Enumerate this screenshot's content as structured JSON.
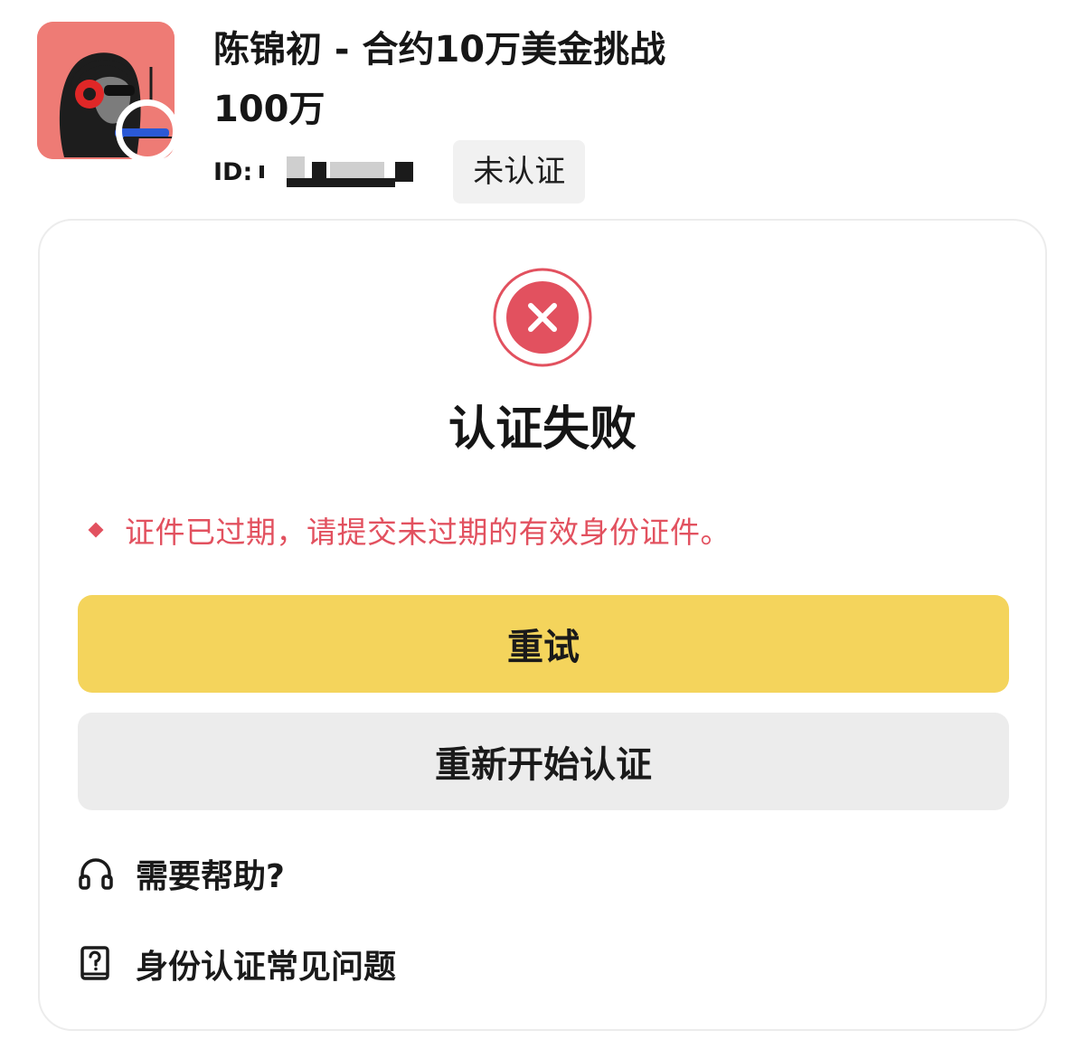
{
  "profile": {
    "name": "陈锦初 - 合约10万美金挑战100万",
    "id_label": "ID:",
    "verification_status": "未认证",
    "avatar_bg_color": "#ee7b75"
  },
  "result": {
    "icon": "close-circle-icon",
    "title": "认证失败",
    "reason": "证件已过期，请提交未过期的有效身份证件。",
    "error_color": "#e2515f"
  },
  "actions": {
    "retry_label": "重试",
    "retry_color": "#f4d45c",
    "restart_label": "重新开始认证",
    "restart_color": "#ececec"
  },
  "links": {
    "help_label": "需要帮助?",
    "help_icon": "headphones-icon",
    "faq_label": "身份认证常见问题",
    "faq_icon": "question-book-icon"
  }
}
